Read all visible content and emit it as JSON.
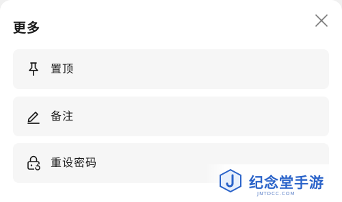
{
  "sheet": {
    "title": "更多",
    "close_icon": "close-icon"
  },
  "menu": {
    "items": [
      {
        "label": "置顶",
        "icon": "pin-icon"
      },
      {
        "label": "备注",
        "icon": "edit-icon"
      },
      {
        "label": "重设密码",
        "icon": "lock-reset-icon"
      }
    ]
  },
  "watermark": {
    "text": "纪念堂手游",
    "subtext": "JNTDCC.COM"
  },
  "colors": {
    "background": "#ffffff",
    "item_background": "#f6f6f6",
    "text": "#1a1a1a",
    "watermark_blue": "#2a63c9"
  }
}
